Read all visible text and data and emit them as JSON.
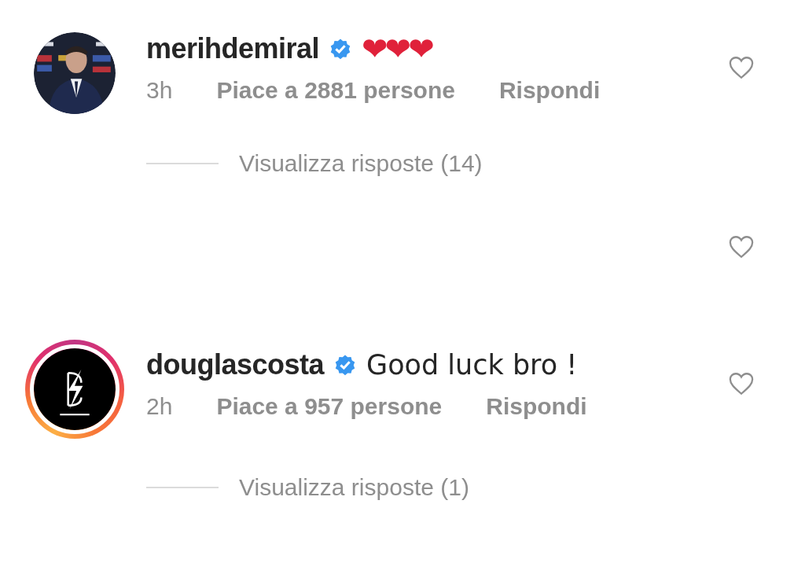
{
  "comments": [
    {
      "kind": "comment",
      "story_ring": false,
      "username": "merihdemiral",
      "verified": true,
      "text": "❤❤❤",
      "time": "3h",
      "likes": "Piace a 2881 persone",
      "reply": "Rispondi",
      "liked": false,
      "view_replies": "Visualizza risposte (14)"
    },
    {
      "kind": "hidden",
      "liked": false
    },
    {
      "kind": "comment",
      "avatar": {
        "kind": "logo"
      },
      "story_ring": true,
      "username": "douglascosta",
      "verified": true,
      "text": "Good luck bro !",
      "time": "2h",
      "likes": "Piace a 957 persone",
      "reply": "Rispondi",
      "liked": false,
      "view_replies": "Visualizza risposte (1)"
    }
  ]
}
